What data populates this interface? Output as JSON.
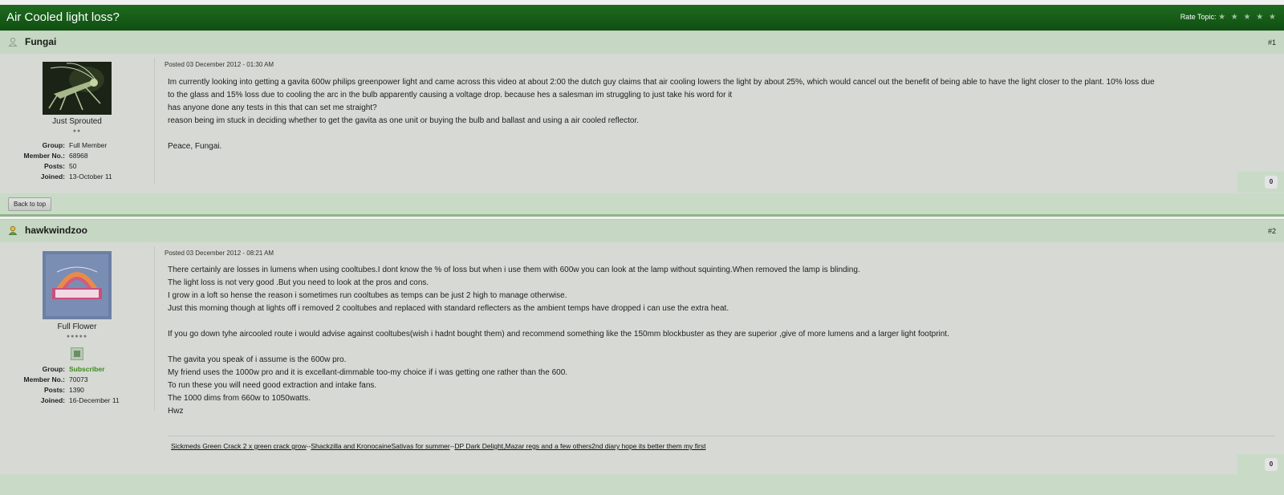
{
  "topic": {
    "title": "Air Cooled light loss?",
    "rate_label": "Rate Topic:",
    "stars": "★ ★ ★ ★ ★"
  },
  "posts": [
    {
      "author": "Fungai",
      "number": "#1",
      "posted": "Posted 03 December 2012 - 01:30 AM",
      "rank": "Just Sprouted",
      "pips": "●●",
      "group_label": "Group:",
      "group": "Full Member",
      "member_label": "Member No.:",
      "member_no": "68968",
      "posts_label": "Posts:",
      "posts": "50",
      "joined_label": "Joined:",
      "joined": "13-October 11",
      "body": [
        "Im currently looking into getting a gavita 600w philips greenpower light and came across this video at about 2:00 the dutch guy claims that air cooling lowers the light by about 25%, which would cancel out the benefit of being able to have the light closer to the plant. 10% loss due",
        "to the glass and 15% loss due to cooling the arc in the bulb apparently causing a voltage drop. because hes a salesman im struggling to just take his word for it",
        "has anyone done any tests in this that can set me straight?",
        "reason being im stuck in deciding whether to get the gavita as one unit or buying the bulb and ballast and using a air cooled reflector.",
        "",
        "Peace, Fungai."
      ],
      "reputation": "0",
      "back_to_top": "Back to top"
    },
    {
      "author": "hawkwindzoo",
      "number": "#2",
      "posted": "Posted 03 December 2012 - 08:21 AM",
      "rank": "Full Flower",
      "pips": "●●●●●",
      "group_label": "Group:",
      "group": "Subscriber",
      "member_label": "Member No.:",
      "member_no": "70073",
      "posts_label": "Posts:",
      "posts": "1390",
      "joined_label": "Joined:",
      "joined": "16-December 11",
      "body": [
        "There certainly are losses in lumens when using cooltubes.I dont know the % of loss but when i use them with 600w you can look at the lamp without squinting.When removed the lamp is blinding.",
        "The light loss is not very good .But you need to look at the pros and cons.",
        "I grow in a loft so hense the reason i sometimes run cooltubes as temps can be just 2 high to manage otherwise.",
        "Just this morning though at lights off i removed 2 cooltubes and replaced with standard reflecters as the ambient temps have dropped i can use the extra heat.",
        "",
        "If you go down tyhe aircooled route i would advise against cooltubes(wish i hadnt bought them) and recommend something like the 150mm blockbuster as they are superior ,give of more lumens and a larger light footprint.",
        "",
        "The gavita you speak of i assume is the 600w pro.",
        "My friend uses the 1000w pro and it is excellant-dimmable too-my choice if i was getting one rather than the 600.",
        "To run these you will need good extraction and intake fans.",
        "The 1000 dims from 660w to 1050watts.",
        "Hwz"
      ],
      "signature": {
        "link1": "Sickmeds Green Crack 2 x green crack grow",
        "sep1": "--",
        "link2": "Shackzilla and KronocaineSativas for summer",
        "sep2": "--",
        "link3": "DP Dark Delight,Mazar regs and a few others2nd diary hope its better them my first"
      },
      "reputation": "0"
    }
  ],
  "colors": {
    "header_green": "#0f4f12",
    "post_bg": "#d6d9d4",
    "subscriber_green": "#3c8a1c"
  }
}
